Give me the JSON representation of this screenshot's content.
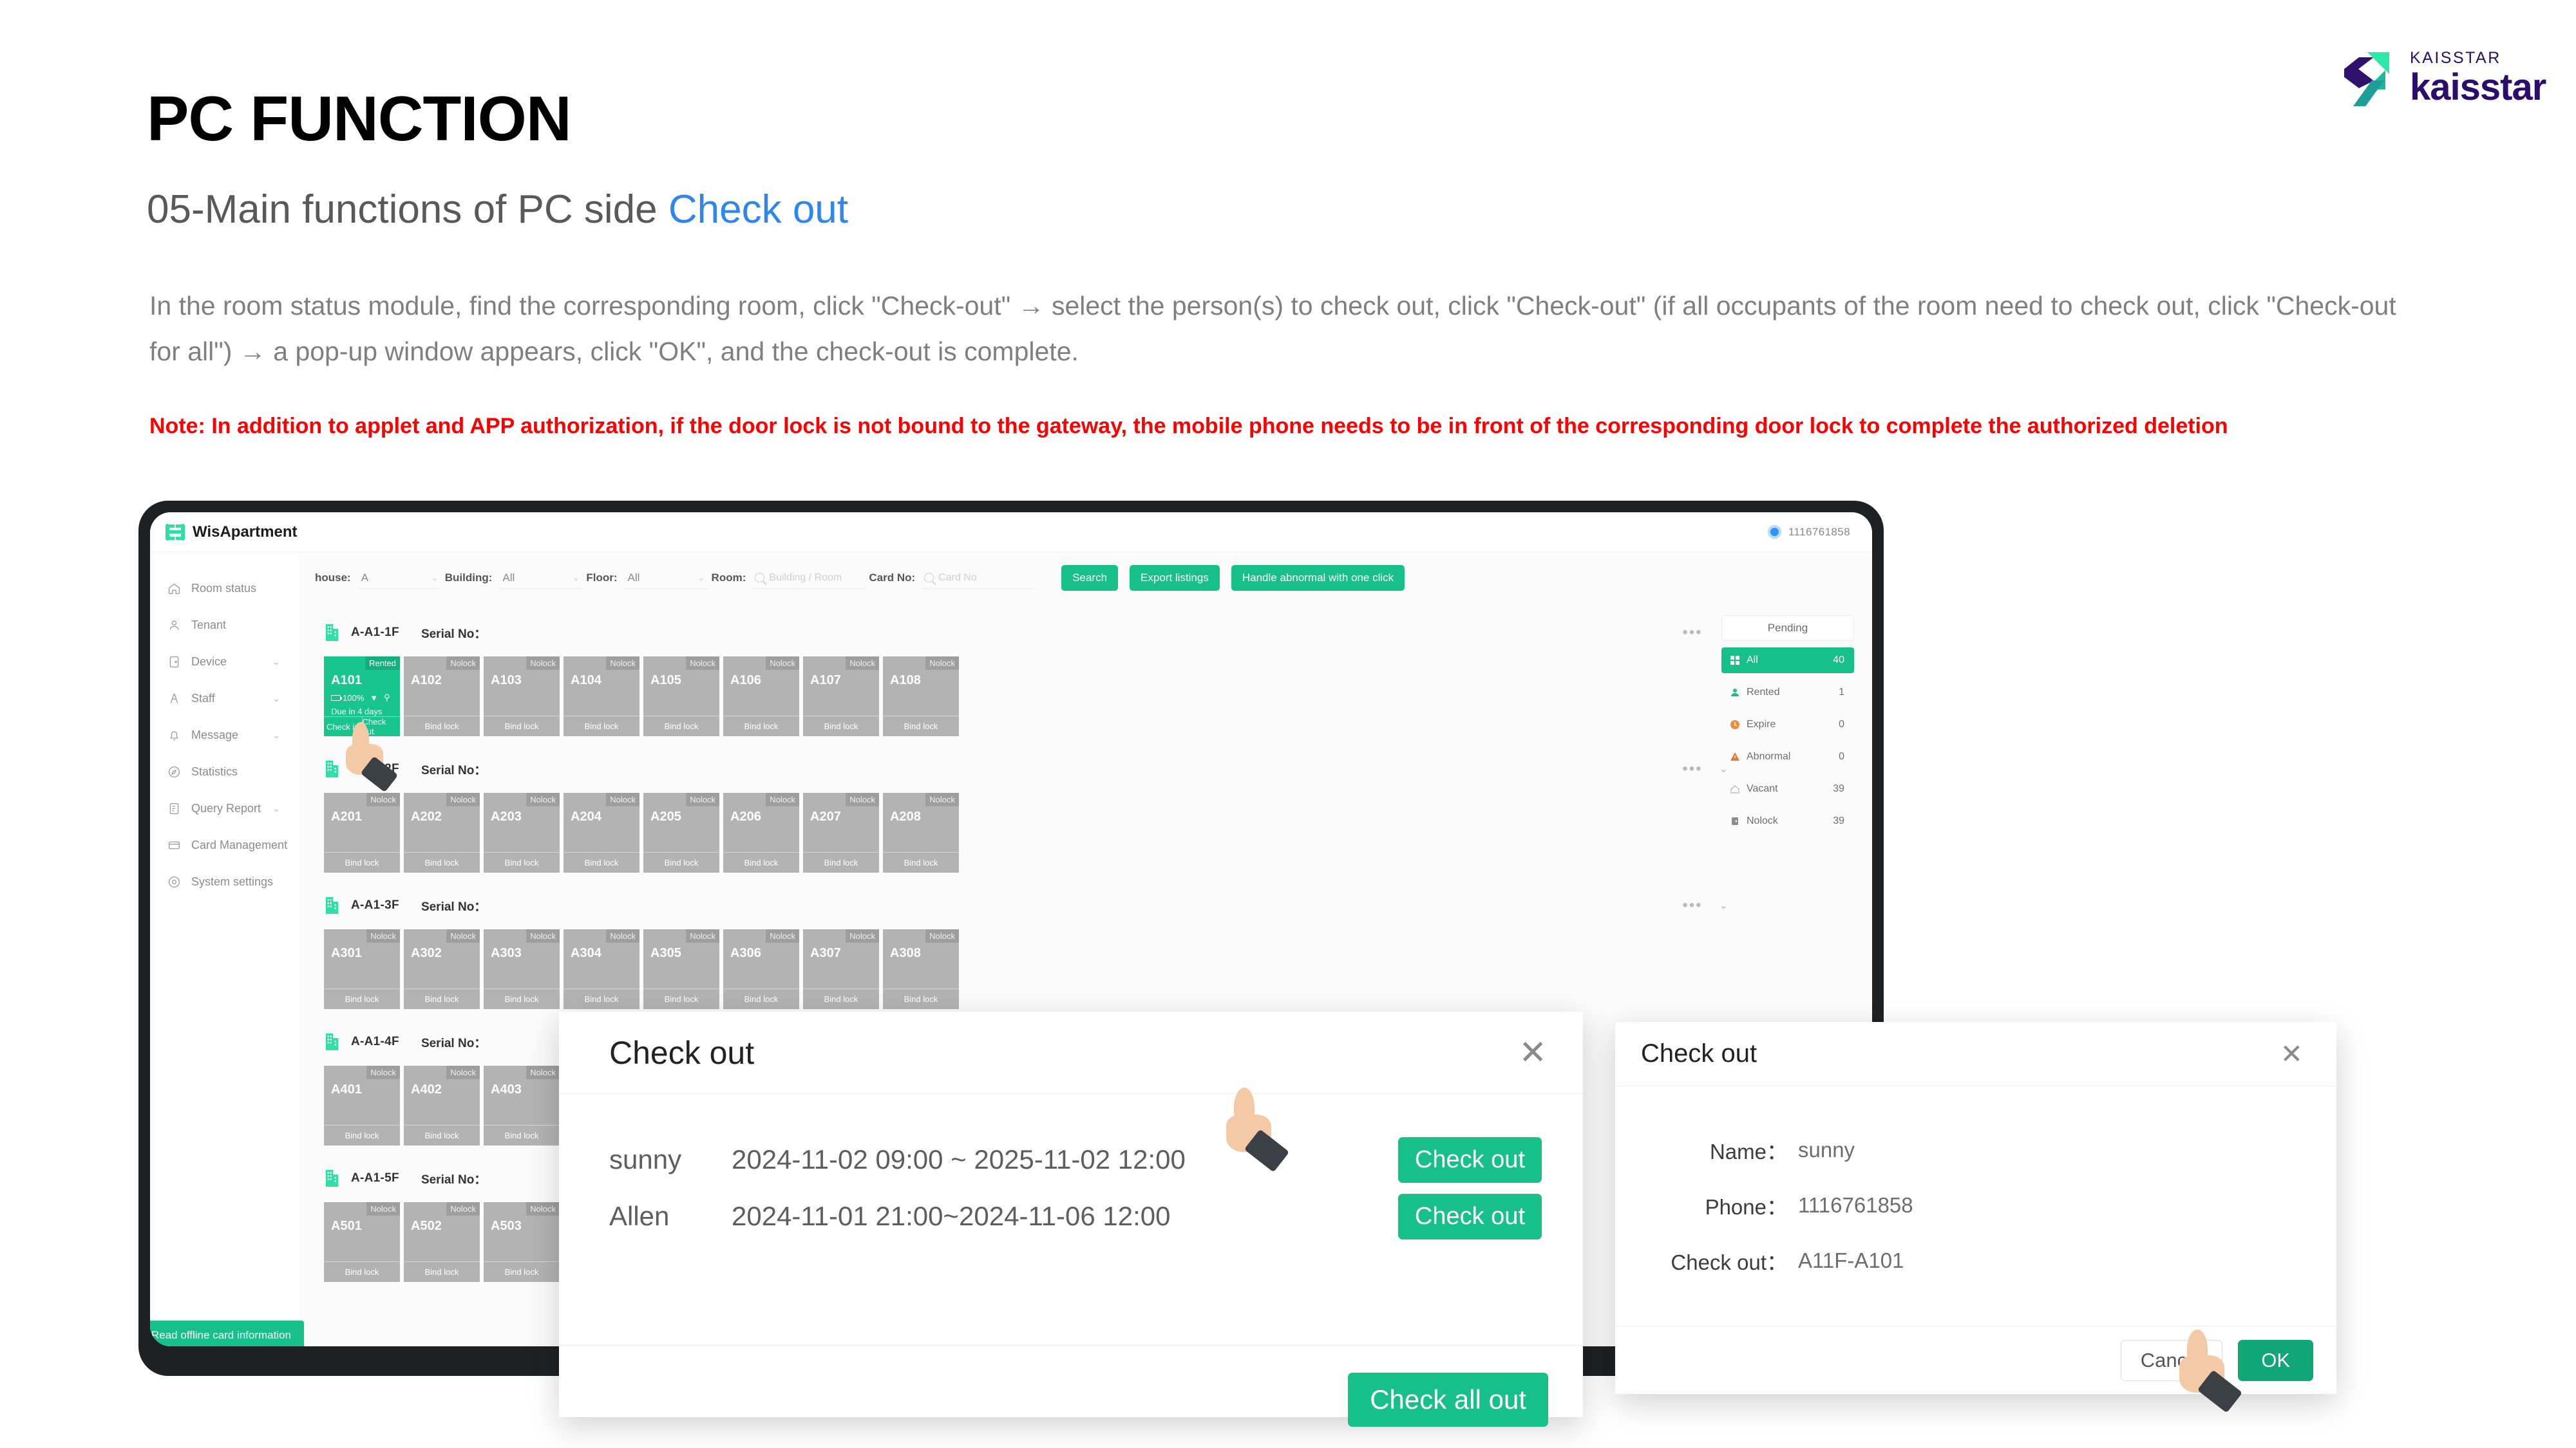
{
  "brand": {
    "logo_small": "KAISSTAR",
    "logo_large": "kaisstar",
    "accent_green": "#16c088",
    "accent_blue": "#2e86f0",
    "logo_purple": "#2b0e6b"
  },
  "slide": {
    "title": "PC FUNCTION",
    "subtitle_prefix": "05-Main functions of PC side ",
    "subtitle_highlight": "Check out",
    "body": "In the room status module, find the corresponding room, click \"Check-out\" → select the person(s) to check out, click \"Check-out\" (if all occupants of the room need to check out, click \"Check-out for all\") → a pop-up window appears, click \"OK\", and the check-out is complete.",
    "note": "Note: In addition to applet and APP authorization, if the door lock is not bound to the gateway, the mobile phone needs to be in front of the corresponding door lock to complete the authorized deletion"
  },
  "app": {
    "name": "WisApartment",
    "account": "1116761858",
    "sidebar": [
      {
        "label": "Room status",
        "icon": "home-icon",
        "caret": ""
      },
      {
        "label": "Tenant",
        "icon": "user-icon",
        "caret": ""
      },
      {
        "label": "Device",
        "icon": "device-icon",
        "caret": "⌄"
      },
      {
        "label": "Staff",
        "icon": "staff-icon",
        "caret": "⌄"
      },
      {
        "label": "Message",
        "icon": "bell-icon",
        "caret": "⌄"
      },
      {
        "label": "Statistics",
        "icon": "compass-icon",
        "caret": ""
      },
      {
        "label": "Query Report",
        "icon": "report-icon",
        "caret": "⌄"
      },
      {
        "label": "Card Management",
        "icon": "card-icon",
        "caret": "⌄"
      },
      {
        "label": "System settings",
        "icon": "gear-icon",
        "caret": ""
      }
    ],
    "filters": [
      {
        "label": "house:",
        "value": "A"
      },
      {
        "label": "Building:",
        "value": "All"
      },
      {
        "label": "Floor:",
        "value": "All"
      }
    ],
    "room_filter": {
      "label": "Room:",
      "placeholder": "Building / Room"
    },
    "card_filter": {
      "label": "Card No:",
      "placeholder": "Card No"
    },
    "buttons": {
      "search": "Search",
      "export": "Export listings",
      "handle_abnormal": "Handle abnormal with one click",
      "offline_card": "Read offline card information"
    },
    "serial_label": "Serial No：",
    "floors": [
      {
        "name": "A-A1-1F",
        "rooms": [
          {
            "no": "A101",
            "tag": "Rented",
            "rented": true,
            "battery": "100%",
            "due": "Due in 4 days",
            "actions": [
              "Check in",
              "Check out"
            ]
          },
          {
            "no": "A102",
            "tag": "Nolock",
            "rented": false,
            "actions": [
              "Bind lock"
            ]
          },
          {
            "no": "A103",
            "tag": "Nolock",
            "rented": false,
            "actions": [
              "Bind lock"
            ]
          },
          {
            "no": "A104",
            "tag": "Nolock",
            "rented": false,
            "actions": [
              "Bind lock"
            ]
          },
          {
            "no": "A105",
            "tag": "Nolock",
            "rented": false,
            "actions": [
              "Bind lock"
            ]
          },
          {
            "no": "A106",
            "tag": "Nolock",
            "rented": false,
            "actions": [
              "Bind lock"
            ]
          },
          {
            "no": "A107",
            "tag": "Nolock",
            "rented": false,
            "actions": [
              "Bind lock"
            ]
          },
          {
            "no": "A108",
            "tag": "Nolock",
            "rented": false,
            "actions": [
              "Bind lock"
            ]
          }
        ]
      },
      {
        "name": "A-A1-2F",
        "rooms": [
          {
            "no": "A201",
            "tag": "Nolock",
            "rented": false,
            "actions": [
              "Bind lock"
            ]
          },
          {
            "no": "A202",
            "tag": "Nolock",
            "rented": false,
            "actions": [
              "Bind lock"
            ]
          },
          {
            "no": "A203",
            "tag": "Nolock",
            "rented": false,
            "actions": [
              "Bind lock"
            ]
          },
          {
            "no": "A204",
            "tag": "Nolock",
            "rented": false,
            "actions": [
              "Bind lock"
            ]
          },
          {
            "no": "A205",
            "tag": "Nolock",
            "rented": false,
            "actions": [
              "Bind lock"
            ]
          },
          {
            "no": "A206",
            "tag": "Nolock",
            "rented": false,
            "actions": [
              "Bind lock"
            ]
          },
          {
            "no": "A207",
            "tag": "Nolock",
            "rented": false,
            "actions": [
              "Bind lock"
            ]
          },
          {
            "no": "A208",
            "tag": "Nolock",
            "rented": false,
            "actions": [
              "Bind lock"
            ]
          }
        ]
      },
      {
        "name": "A-A1-3F",
        "rooms": [
          {
            "no": "A301",
            "tag": "Nolock",
            "rented": false,
            "actions": [
              "Bind lock"
            ]
          },
          {
            "no": "A302",
            "tag": "Nolock",
            "rented": false,
            "actions": [
              "Bind lock"
            ]
          },
          {
            "no": "A303",
            "tag": "Nolock",
            "rented": false,
            "actions": [
              "Bind lock"
            ]
          },
          {
            "no": "A304",
            "tag": "Nolock",
            "rented": false,
            "actions": [
              "Bind lock"
            ]
          },
          {
            "no": "A305",
            "tag": "Nolock",
            "rented": false,
            "actions": [
              "Bind lock"
            ]
          },
          {
            "no": "A306",
            "tag": "Nolock",
            "rented": false,
            "actions": [
              "Bind lock"
            ]
          },
          {
            "no": "A307",
            "tag": "Nolock",
            "rented": false,
            "actions": [
              "Bind lock"
            ]
          },
          {
            "no": "A308",
            "tag": "Nolock",
            "rented": false,
            "actions": [
              "Bind lock"
            ]
          }
        ]
      },
      {
        "name": "A-A1-4F",
        "rooms": [
          {
            "no": "A401",
            "tag": "Nolock",
            "rented": false,
            "actions": [
              "Bind lock"
            ]
          },
          {
            "no": "A402",
            "tag": "Nolock",
            "rented": false,
            "actions": [
              "Bind lock"
            ]
          },
          {
            "no": "A403",
            "tag": "Nolock",
            "rented": false,
            "actions": [
              "Bind lock"
            ]
          }
        ]
      },
      {
        "name": "A-A1-5F",
        "rooms": [
          {
            "no": "A501",
            "tag": "Nolock",
            "rented": false,
            "actions": [
              "Bind lock"
            ]
          },
          {
            "no": "A502",
            "tag": "Nolock",
            "rented": false,
            "actions": [
              "Bind lock"
            ]
          },
          {
            "no": "A503",
            "tag": "Nolock",
            "rented": false,
            "actions": [
              "Bind lock"
            ]
          }
        ]
      }
    ],
    "stats": {
      "pending_label": "Pending",
      "rows": [
        {
          "label": "All",
          "count": "40",
          "icon": "grid-icon",
          "active": true,
          "color": "#ffffff"
        },
        {
          "label": "Rented",
          "count": "1",
          "icon": "person-icon",
          "active": false,
          "color": "#16c088"
        },
        {
          "label": "Expire",
          "count": "0",
          "icon": "clock-icon",
          "active": false,
          "color": "#f08a3c"
        },
        {
          "label": "Abnormal",
          "count": "0",
          "icon": "warning-icon",
          "active": false,
          "color": "#e8763a"
        },
        {
          "label": "Vacant",
          "count": "39",
          "icon": "house-icon",
          "active": false,
          "color": "#b5b5b5"
        },
        {
          "label": "Nolock",
          "count": "39",
          "icon": "lock-icon",
          "active": false,
          "color": "#8d8d8d"
        }
      ]
    }
  },
  "dialog_list": {
    "title": "Check out",
    "close": "✕",
    "rows": [
      {
        "name": "sunny",
        "period": "2024-11-02 09:00 ~ 2025-11-02 12:00",
        "action": "Check out"
      },
      {
        "name": "Allen",
        "period": "2024-11-01 21:00~2024-11-06 12:00",
        "action": "Check out"
      }
    ],
    "check_all": "Check all out"
  },
  "dialog_confirm": {
    "title": "Check out",
    "close": "✕",
    "fields": [
      {
        "key": "Name：",
        "value": "sunny"
      },
      {
        "key": "Phone：",
        "value": "1116761858"
      },
      {
        "key": "Check out：",
        "value": "A11F-A101"
      }
    ],
    "cancel": "Cancel",
    "ok": "OK"
  }
}
